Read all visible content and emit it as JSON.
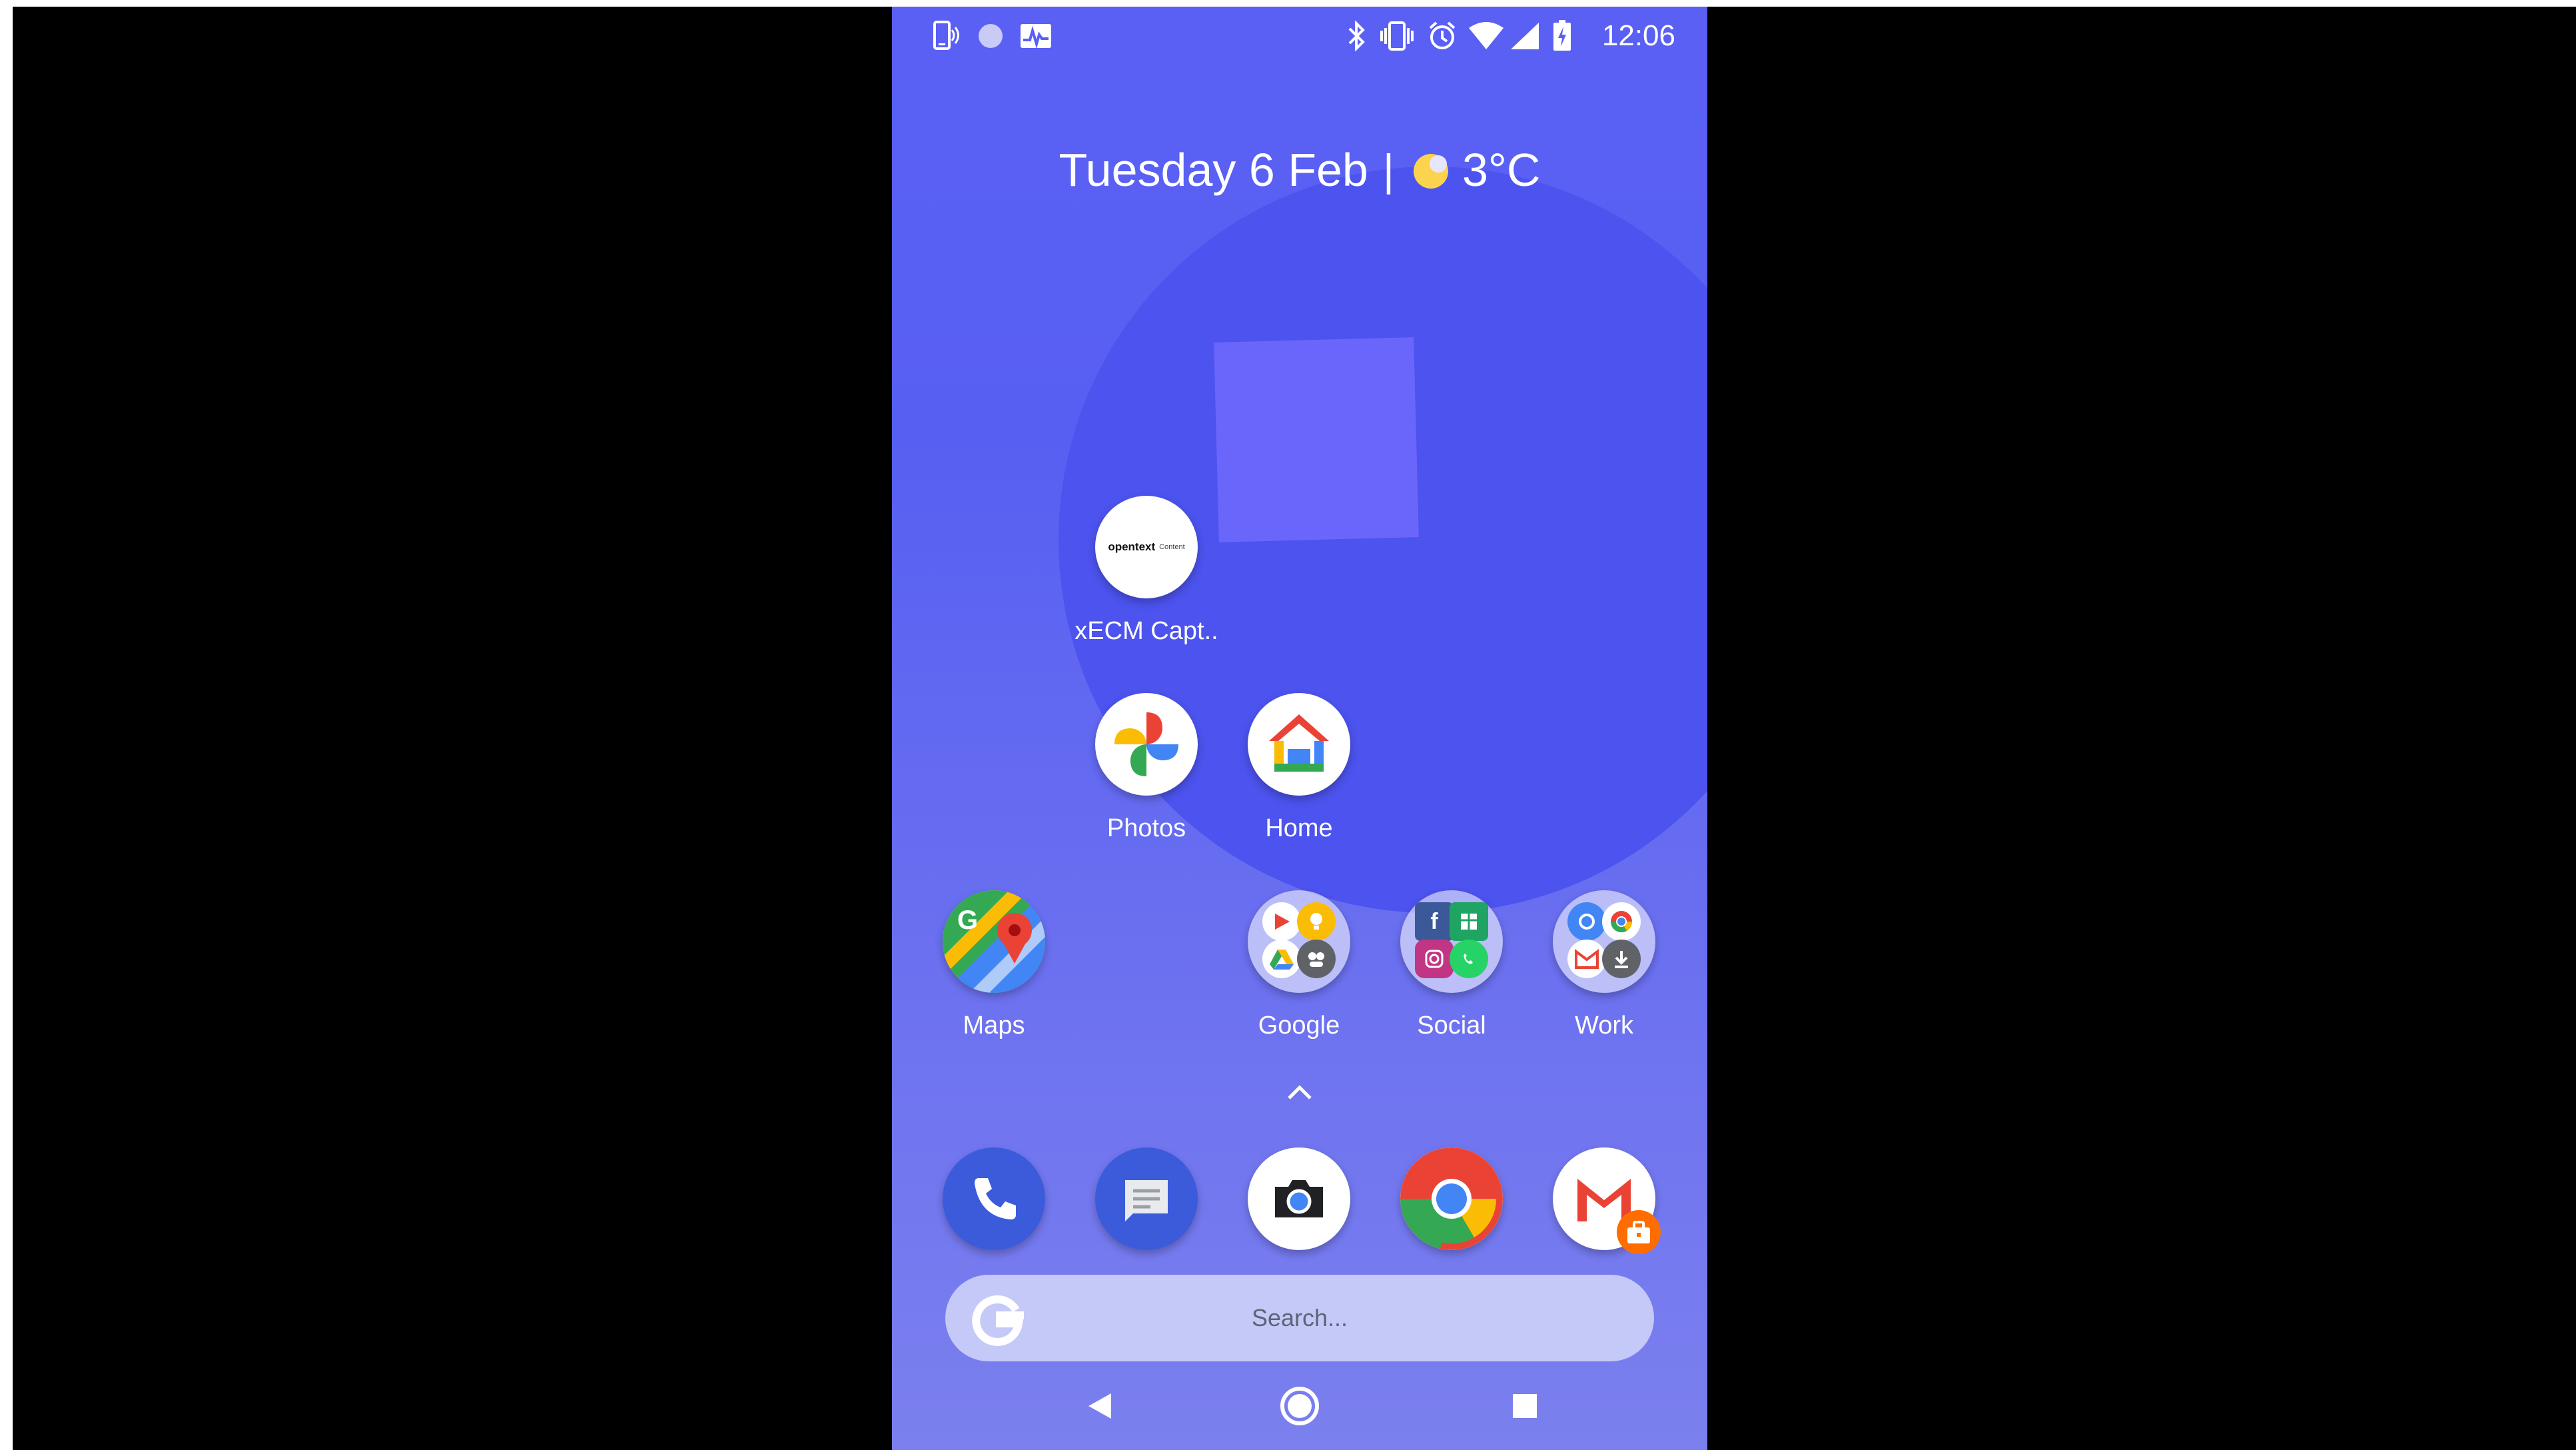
{
  "status_bar": {
    "time": "12:06",
    "left_icons": [
      "cast-phone-icon",
      "circle-notification-icon",
      "activity-monitor-icon"
    ],
    "right_icons": [
      "bluetooth-icon",
      "vibrate-icon",
      "alarm-icon",
      "wifi-icon",
      "cell-signal-icon",
      "battery-charging-icon"
    ]
  },
  "glance": {
    "date": "Tuesday 6 Feb",
    "separator": "|",
    "temperature": "3°C",
    "weather_icon": "partly-cloudy-icon"
  },
  "apps": {
    "xecm": {
      "label": "xECM Capt..",
      "logo_text": "opentext",
      "logo_sub": "Content"
    },
    "photos": {
      "label": "Photos"
    },
    "home": {
      "label": "Home"
    },
    "maps": {
      "label": "Maps"
    },
    "google": {
      "label": "Google"
    },
    "social": {
      "label": "Social"
    },
    "work": {
      "label": "Work"
    }
  },
  "dock": {
    "apps": [
      "phone-icon",
      "messages-icon",
      "camera-icon",
      "chrome-icon",
      "gmail-work-icon"
    ]
  },
  "search": {
    "placeholder": "Search..."
  },
  "nav": [
    "back-icon",
    "home-icon",
    "recents-icon"
  ],
  "colors": {
    "wallpaper": "#5a60f4",
    "circle": "#4c53ee",
    "square": "#6b66fb",
    "search_bar": "#c5c9f8"
  }
}
